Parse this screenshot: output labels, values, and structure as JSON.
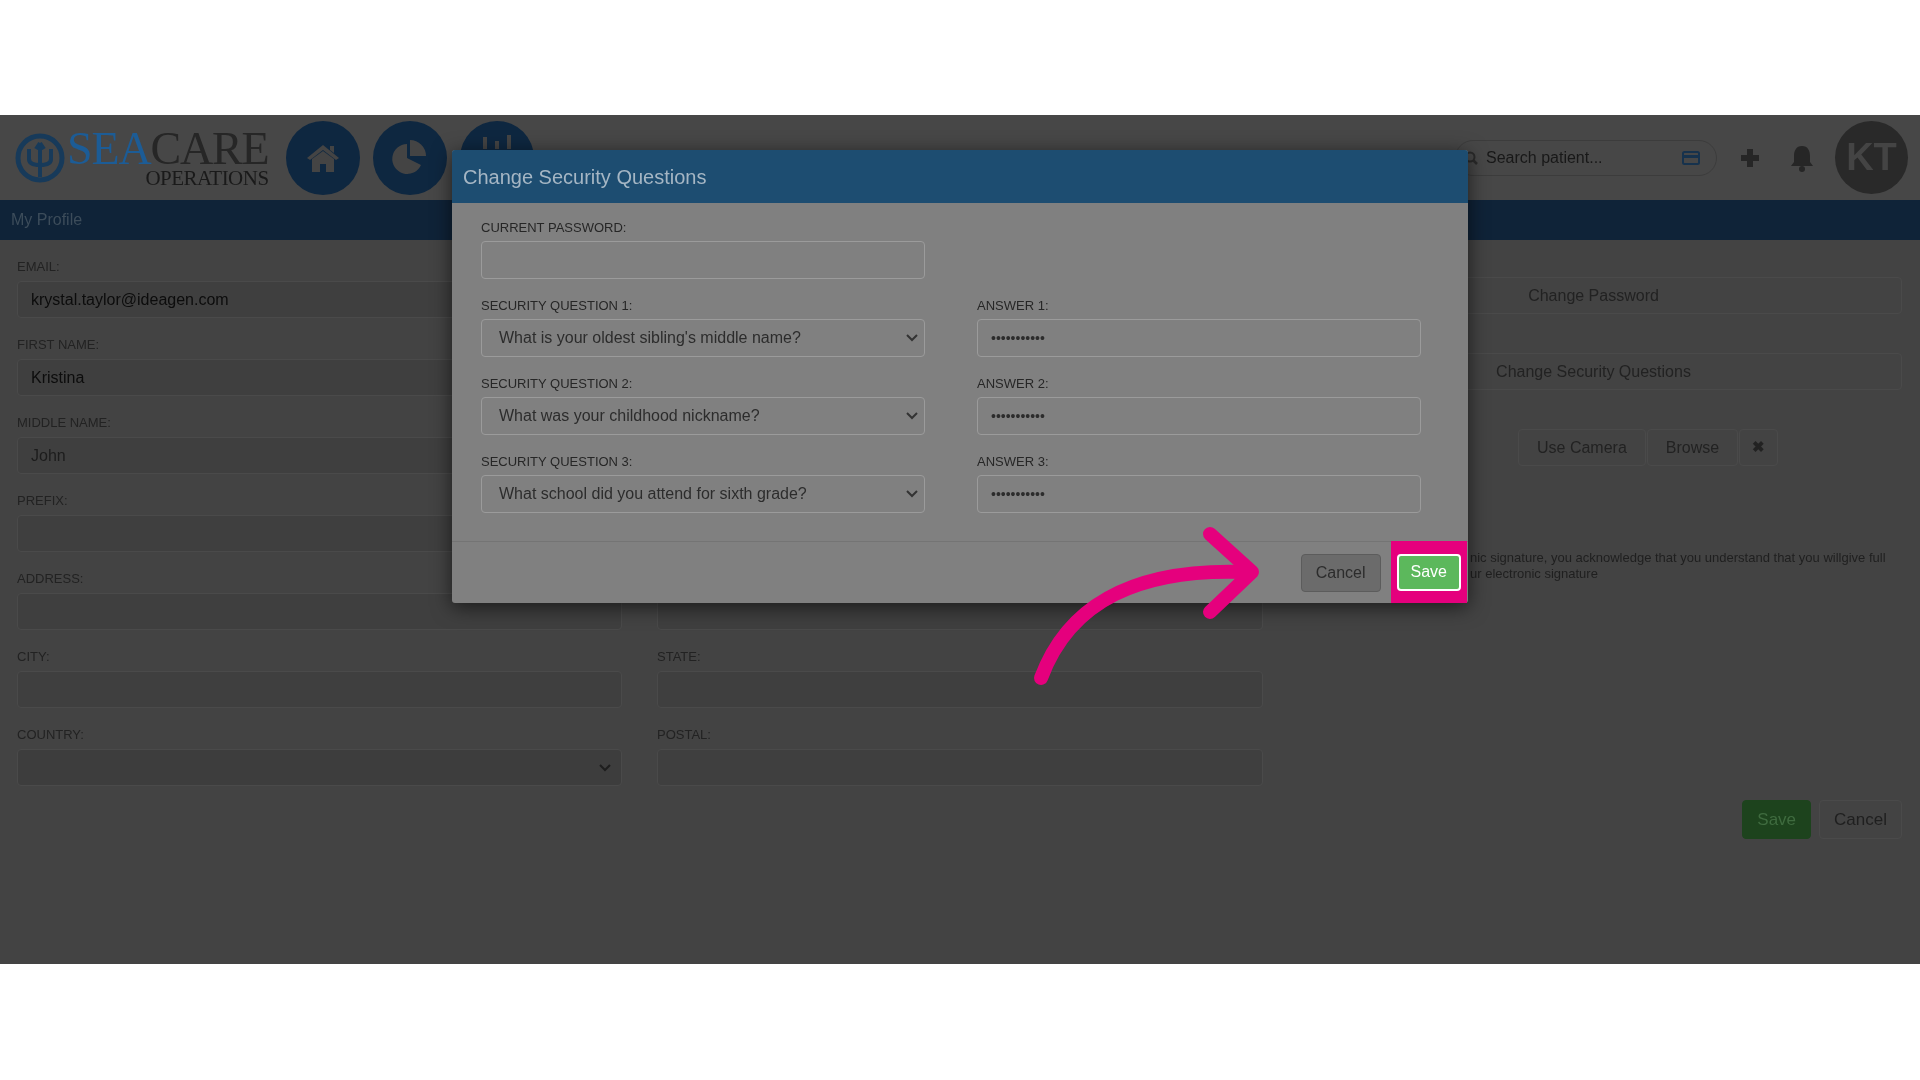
{
  "header": {
    "logo": {
      "primary": "SEA",
      "secondary": "CARE",
      "tagline": "OPERATIONS"
    },
    "search": {
      "placeholder": "Search patient..."
    },
    "avatar": "KT"
  },
  "nav": {
    "title": "My Profile"
  },
  "form": {
    "rows": [
      {
        "left": {
          "label": "EMAIL:",
          "kind": "input",
          "value": "krystal.taylor@ideagen.com"
        }
      },
      {
        "left": {
          "label": "FIRST NAME:",
          "kind": "input",
          "value": "Kristina"
        }
      },
      {
        "left": {
          "label": "MIDDLE NAME:",
          "kind": "input",
          "placeholder": "John"
        }
      },
      {
        "left": {
          "label": "PREFIX:",
          "kind": "input"
        }
      },
      {
        "left": {
          "label": "ADDRESS:",
          "kind": "input"
        },
        "right": {
          "kind": "input"
        }
      },
      {
        "left": {
          "label": "CITY:",
          "kind": "input"
        },
        "right": {
          "label": "STATE:",
          "kind": "input"
        }
      },
      {
        "left": {
          "label": "COUNTRY:",
          "kind": "select"
        },
        "right": {
          "label": "POSTAL:",
          "kind": "input"
        }
      }
    ]
  },
  "side": {
    "buttons": [
      "Change Password",
      "Change Security Questions"
    ],
    "photo_buttons": [
      "Use Camera",
      "Browse",
      "✖"
    ],
    "signature_lines": [
      "nic signature, you acknowledge that you understand that you willgive full",
      "ur electronic signature"
    ],
    "footer_buttons": [
      {
        "label": "Save",
        "kind": "primary"
      },
      {
        "label": "Cancel",
        "kind": "default"
      }
    ]
  },
  "modal": {
    "title": "Change Security Questions",
    "current_password": {
      "label": "CURRENT PASSWORD:"
    },
    "questions": [
      {
        "label": "SECURITY QUESTION 1:",
        "value": "What is your oldest sibling's middle name?",
        "answer_label": "ANSWER 1:",
        "answer_value": "•••••••••••"
      },
      {
        "label": "SECURITY QUESTION 2:",
        "value": "What was your childhood nickname?",
        "answer_label": "ANSWER 2:",
        "answer_value": "•••••••••••"
      },
      {
        "label": "SECURITY QUESTION 3:",
        "value": "What school did you attend for sixth grade?",
        "answer_label": "ANSWER 3:",
        "answer_value": "•••••••••••"
      }
    ],
    "buttons": [
      {
        "label": "Cancel",
        "kind": "default",
        "highlighted": false
      },
      {
        "label": "Save",
        "kind": "primary",
        "highlighted": true
      }
    ]
  }
}
